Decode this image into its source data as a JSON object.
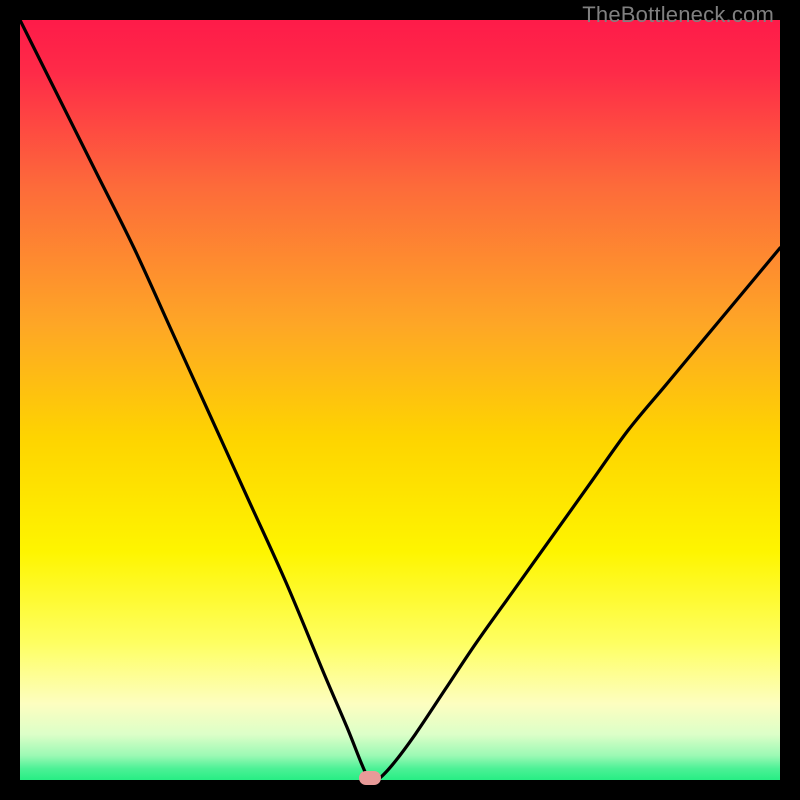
{
  "watermark": "TheBottleneck.com",
  "colors": {
    "gradient_top": "#fe1b49",
    "gradient_mid": "#fed400",
    "gradient_yellowwhite": "#fdfec0",
    "gradient_green": "#27ee84",
    "curve": "#000000",
    "marker": "#e89a98",
    "frame": "#000000"
  },
  "chart_data": {
    "type": "line",
    "title": "",
    "xlabel": "",
    "ylabel": "",
    "xlim": [
      0,
      100
    ],
    "ylim": [
      0,
      100
    ],
    "grid": false,
    "legend": false,
    "curve": {
      "description": "Bottleneck percentage vs. component balance; V-shaped curve dipping to 0 near x≈46",
      "x": [
        0,
        5,
        10,
        15,
        20,
        25,
        30,
        35,
        40,
        43,
        45,
        46,
        47,
        49,
        52,
        56,
        60,
        65,
        70,
        75,
        80,
        85,
        90,
        95,
        100
      ],
      "y": [
        100,
        90,
        80,
        70,
        59,
        48,
        37,
        26,
        14,
        7,
        2,
        0,
        0,
        2,
        6,
        12,
        18,
        25,
        32,
        39,
        46,
        52,
        58,
        64,
        70
      ]
    },
    "marker_point": {
      "x": 46,
      "y": 0
    }
  },
  "gradient_stops": [
    {
      "offset": 0.0,
      "color": "#fe1b49"
    },
    {
      "offset": 0.07,
      "color": "#fe2b48"
    },
    {
      "offset": 0.22,
      "color": "#fd6b3a"
    },
    {
      "offset": 0.4,
      "color": "#fea626"
    },
    {
      "offset": 0.55,
      "color": "#fed400"
    },
    {
      "offset": 0.7,
      "color": "#fef500"
    },
    {
      "offset": 0.82,
      "color": "#feff62"
    },
    {
      "offset": 0.9,
      "color": "#fdfec0"
    },
    {
      "offset": 0.94,
      "color": "#dcffc8"
    },
    {
      "offset": 0.968,
      "color": "#9bf9b4"
    },
    {
      "offset": 0.985,
      "color": "#4cf196"
    },
    {
      "offset": 1.0,
      "color": "#27ee84"
    }
  ]
}
